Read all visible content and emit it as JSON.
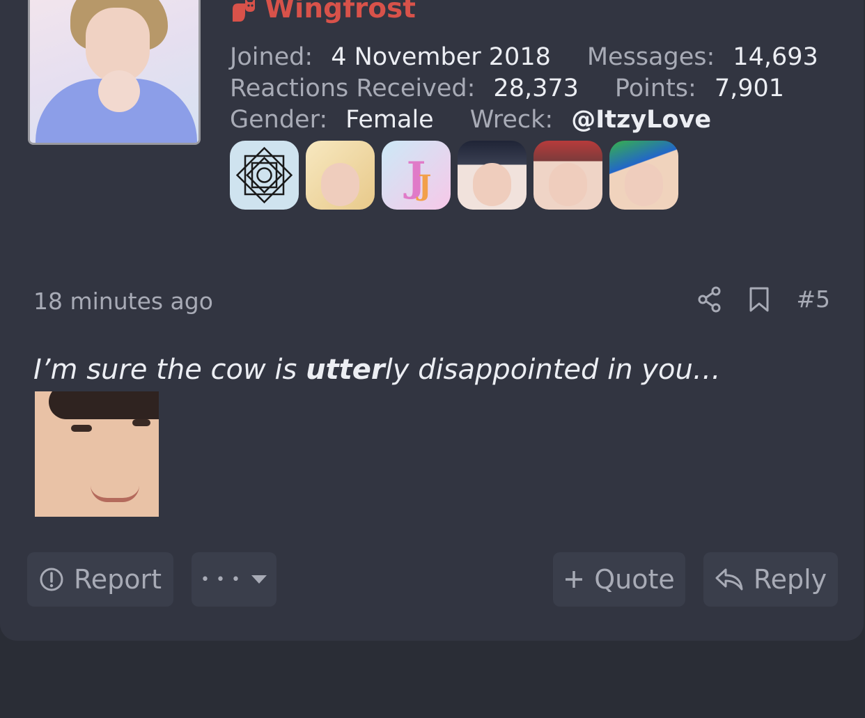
{
  "user": {
    "name": "Wingfrost",
    "joined_label": "Joined:",
    "joined_value": "4 November 2018",
    "messages_label": "Messages:",
    "messages_value": "14,693",
    "reactions_label": "Reactions Received:",
    "reactions_value": "28,373",
    "points_label": "Points:",
    "points_value": "7,901",
    "gender_label": "Gender:",
    "gender_value": "Female",
    "wreck_label": "Wreck:",
    "wreck_value": "@ItzyLove"
  },
  "post": {
    "time": "18 minutes ago",
    "number": "#5",
    "message_part1": "I’m sure the cow is ",
    "message_bold": "utter",
    "message_part2": "ly disappointed in you…"
  },
  "actions": {
    "report": "Report",
    "more": "• • •",
    "quote": "Quote",
    "reply": "Reply"
  },
  "colors": {
    "username": "#d8524a",
    "card_bg": "#323541",
    "page_bg": "#2a2d36",
    "button_bg": "#3a3e4b"
  }
}
